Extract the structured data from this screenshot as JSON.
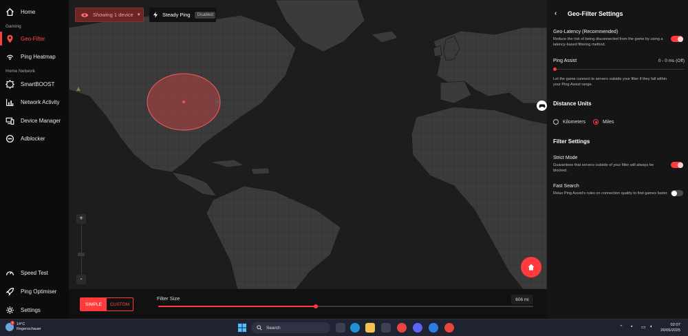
{
  "sidebar": {
    "items": [
      {
        "label": "Home",
        "icon": "home-icon"
      },
      {
        "label": "Geo-Filter",
        "icon": "location-pin-icon",
        "active": true
      },
      {
        "label": "Ping Heatmap",
        "icon": "signal-icon"
      },
      {
        "label": "SmartBOOST",
        "icon": "gear-badge-icon"
      },
      {
        "label": "Network Activity",
        "icon": "bar-chart-icon"
      },
      {
        "label": "Device Manager",
        "icon": "devices-icon"
      },
      {
        "label": "Adblocker",
        "icon": "block-icon"
      },
      {
        "label": "Speed Test",
        "icon": "speedometer-icon"
      },
      {
        "label": "Ping Optimiser",
        "icon": "rocket-icon"
      },
      {
        "label": "Settings",
        "icon": "settings-icon"
      }
    ],
    "sections": {
      "gaming": "Gaming",
      "home_network": "Home Network"
    }
  },
  "map": {
    "devices_button": "Showing 1 device",
    "steady_ping_label": "Steady Ping",
    "steady_ping_status": "Disabled",
    "zoom_in": "+",
    "zoom_out": "-",
    "zoom_level": 0.4
  },
  "bottom": {
    "mode_simple": "SIMPLE",
    "mode_custom": "CUSTOM",
    "filter_label": "Filter Size",
    "filter_value": "606 mi",
    "filter_fraction": 0.42
  },
  "panel": {
    "title": "Geo-Filter Settings",
    "geo_latency": {
      "title": "Geo-Latency (Recommended)",
      "desc": "Reduce the risk of being disconnected from the game by using a latency-based filtering method.",
      "enabled": true
    },
    "ping_assist": {
      "title": "Ping Assist",
      "value": "0 - 0 ms  (Off)",
      "desc": "Let the game connect to servers outside your filter if they fall within your Ping Assist range."
    },
    "distance_units": {
      "heading": "Distance Units",
      "kilometers": "Kilometers",
      "miles": "Miles",
      "selected": "Miles"
    },
    "filter_settings": {
      "heading": "Filter Settings",
      "strict_title": "Strict Mode",
      "strict_desc": "Guarantees that servers outside of your filter will always be blocked.",
      "strict_enabled": true,
      "fast_title": "Fast Search",
      "fast_desc": "Relax Ping Assist's rules on connection quality to find games faster.",
      "fast_enabled": false
    }
  },
  "taskbar": {
    "weather_temp": "14°C",
    "weather_desc": "Regenschauer",
    "weather_badge": "1",
    "search_placeholder": "Search",
    "time": "02:07",
    "date": "26/05/2025"
  },
  "colors": {
    "accent": "#ff3b3b",
    "map_land": "#3b3b3b",
    "map_ocean": "#1d1d1d",
    "panel_bg": "#151515"
  }
}
